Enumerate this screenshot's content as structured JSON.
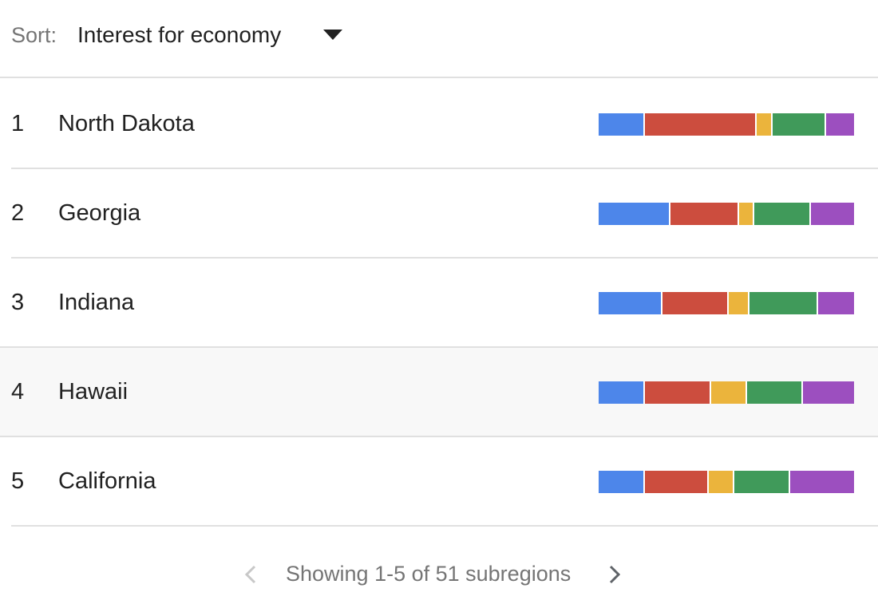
{
  "sort": {
    "label": "Sort:",
    "value": "Interest for economy"
  },
  "colors": {
    "blue": "#4d86ea",
    "red": "#cc4d3e",
    "yellow": "#ebb43c",
    "green": "#409a5a",
    "purple": "#9c4fbf"
  },
  "rows": [
    {
      "rank": "1",
      "region": "North Dakota",
      "shares": [
        18,
        44,
        6,
        21,
        11
      ]
    },
    {
      "rank": "2",
      "region": "Georgia",
      "shares": [
        28,
        27,
        6,
        22,
        17
      ]
    },
    {
      "rank": "3",
      "region": "Indiana",
      "shares": [
        25,
        26,
        8,
        27,
        14
      ]
    },
    {
      "rank": "4",
      "region": "Hawaii",
      "shares": [
        18,
        26,
        14,
        22,
        20
      ]
    },
    {
      "rank": "5",
      "region": "California",
      "shares": [
        18,
        25,
        10,
        22,
        25
      ]
    }
  ],
  "pagination": {
    "status": "Showing 1-5 of 51 subregions",
    "prev_icon": "chevron-left-icon",
    "next_icon": "chevron-right-icon"
  }
}
